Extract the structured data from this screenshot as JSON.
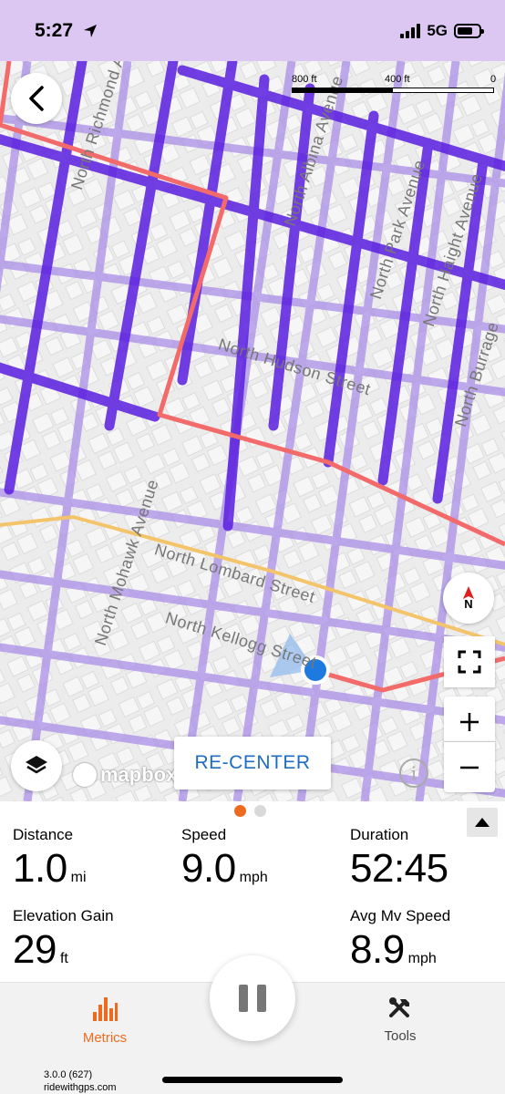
{
  "status_bar": {
    "time": "5:27",
    "network": "5G",
    "icons": [
      "location-arrow-icon",
      "signal-icon",
      "battery-icon"
    ]
  },
  "map": {
    "scale_labels": [
      "800 ft",
      "400 ft",
      "0"
    ],
    "streets": [
      "North Richmond Avenue",
      "North Hudson Street",
      "North Mohawk Avenue",
      "North Lombard Street",
      "North Kellogg Street",
      "North Albina Avenue",
      "North Park Avenue",
      "North Haight Avenue",
      "North Burrage",
      "North"
    ],
    "compass_label": "N",
    "attribution": "mapbox",
    "recenter_label": "RE-CENTER",
    "colors": {
      "route": "#f26a6a",
      "heatmap": "#5a1ee0",
      "location": "#1f7ae0"
    }
  },
  "pager": {
    "pages": 2,
    "active": 0
  },
  "metrics": {
    "distance": {
      "label": "Distance",
      "value": "1.0",
      "unit": "mi"
    },
    "speed": {
      "label": "Speed",
      "value": "9.0",
      "unit": "mph"
    },
    "duration": {
      "label": "Duration",
      "value": "52:45"
    },
    "elevation_gain": {
      "label": "Elevation Gain",
      "value": "29",
      "unit": "ft"
    },
    "avg_moving_speed": {
      "label": "Avg Mv Speed",
      "value": "8.9",
      "unit": "mph"
    }
  },
  "tabbar": {
    "metrics_label": "Metrics",
    "tools_label": "Tools",
    "accent": "#ee6a1e"
  },
  "footer": {
    "version": "3.0.0 (627)",
    "site": "ridewithgps.com"
  }
}
